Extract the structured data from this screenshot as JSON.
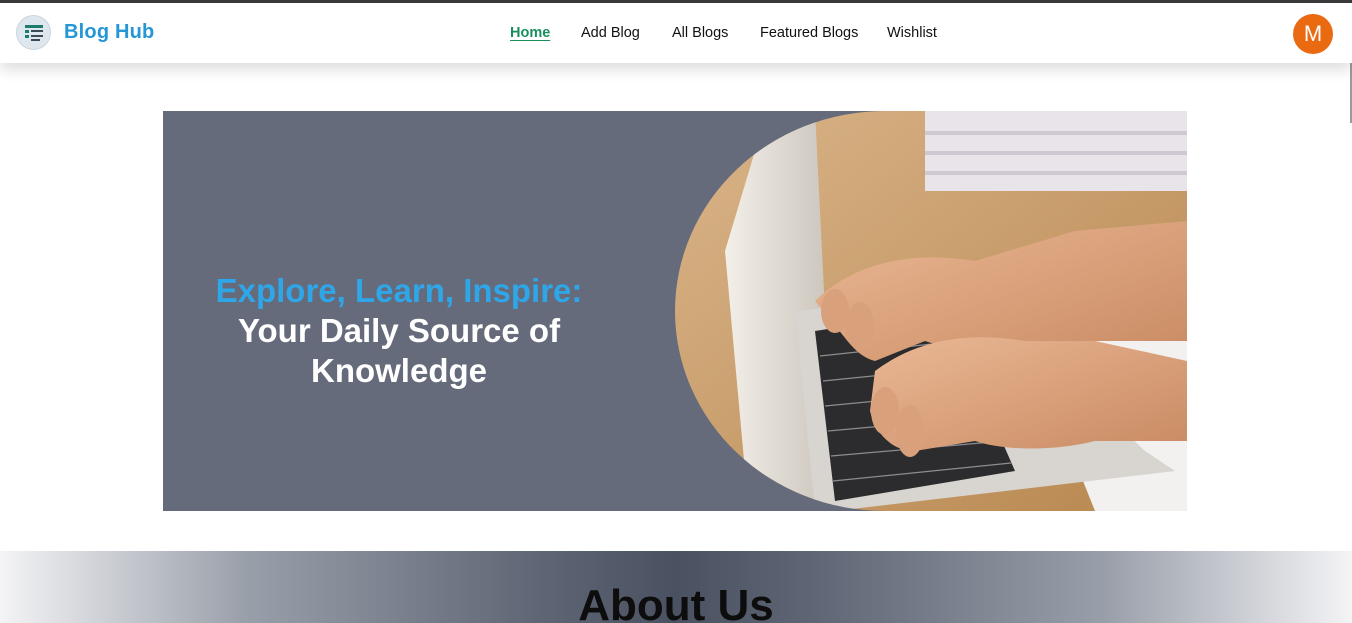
{
  "brand": {
    "name": "Blog Hub",
    "logo_icon": "blog-list-icon"
  },
  "nav": {
    "items": [
      {
        "label": "Home",
        "active": true
      },
      {
        "label": "Add Blog",
        "active": false
      },
      {
        "label": "All Blogs",
        "active": false
      },
      {
        "label": "Featured Blogs",
        "active": false
      },
      {
        "label": "Wishlist",
        "active": false
      }
    ]
  },
  "user": {
    "avatar_initial": "M"
  },
  "hero": {
    "headline_accent": "Explore, Learn, Inspire:",
    "headline_main": "Your Daily Source of Knowledge",
    "image_subject": "hands-typing-on-laptop"
  },
  "about": {
    "title": "About Us"
  },
  "colors": {
    "brand_blue": "#2596d6",
    "active_green": "#1a8f5e",
    "avatar_orange": "#ea6a12",
    "hero_bg": "#656b7a",
    "headline_accent": "#2fa6e8"
  }
}
